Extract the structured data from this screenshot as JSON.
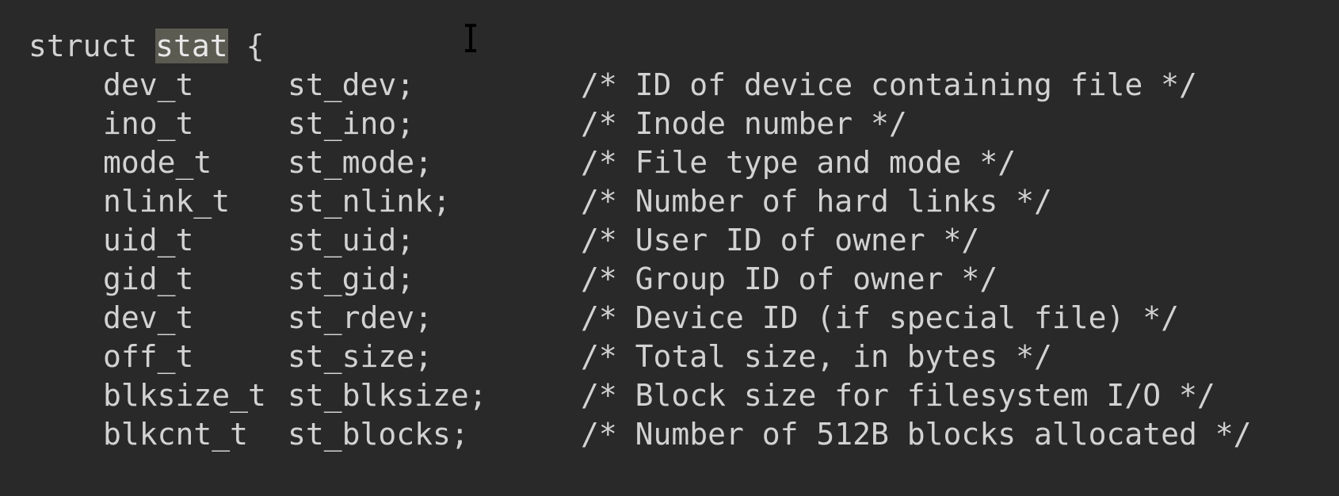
{
  "struct": {
    "keyword": "struct",
    "name": "stat",
    "open_brace": "{"
  },
  "fields": [
    {
      "type": "dev_t",
      "name": "st_dev;",
      "comment": "/* ID of device containing file */"
    },
    {
      "type": "ino_t",
      "name": "st_ino;",
      "comment": "/* Inode number */"
    },
    {
      "type": "mode_t",
      "name": "st_mode;",
      "comment": "/* File type and mode */"
    },
    {
      "type": "nlink_t",
      "name": "st_nlink;",
      "comment": "/* Number of hard links */"
    },
    {
      "type": "uid_t",
      "name": "st_uid;",
      "comment": "/* User ID of owner */"
    },
    {
      "type": "gid_t",
      "name": "st_gid;",
      "comment": "/* Group ID of owner */"
    },
    {
      "type": "dev_t",
      "name": "st_rdev;",
      "comment": "/* Device ID (if special file) */"
    },
    {
      "type": "off_t",
      "name": "st_size;",
      "comment": "/* Total size, in bytes */"
    },
    {
      "type": "blksize_t",
      "name": "st_blksize;",
      "comment": "/* Block size for filesystem I/O */"
    },
    {
      "type": "blkcnt_t",
      "name": "st_blocks;",
      "comment": "/* Number of 512B blocks allocated */"
    }
  ],
  "colors": {
    "background": "#292929",
    "text": "#d2d2d2",
    "selection": "#5b5b52"
  },
  "cursor": {
    "icon": "text-cursor-icon"
  }
}
